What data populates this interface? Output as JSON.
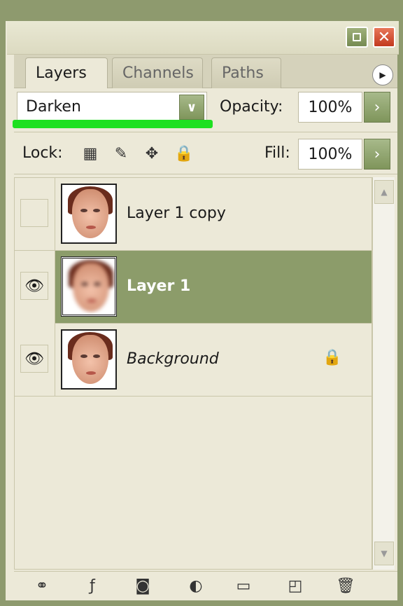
{
  "tabs": [
    {
      "label": "Layers"
    },
    {
      "label": "Channels"
    },
    {
      "label": "Paths"
    }
  ],
  "blend": {
    "value": "Darken"
  },
  "opacity": {
    "label": "Opacity:",
    "value": "100%"
  },
  "lock": {
    "label": "Lock:"
  },
  "fill": {
    "label": "Fill:",
    "value": "100%"
  },
  "layers": [
    {
      "name": "Layer 1 copy",
      "visible": false,
      "selected": false
    },
    {
      "name": "Layer 1",
      "visible": true,
      "selected": true
    },
    {
      "name": "Background",
      "visible": true,
      "selected": false,
      "locked": true
    }
  ],
  "colors": {
    "accent": "#8c9c6a",
    "highlight_line": "#1ee021",
    "close": "#c2391e"
  },
  "icons": {
    "titlebar": [
      "minimize-icon",
      "close-icon"
    ],
    "lock": [
      "lock-transparent-icon",
      "lock-image-icon",
      "lock-position-icon",
      "lock-all-icon"
    ],
    "bottom": [
      "link-layers-icon",
      "layer-style-icon",
      "layer-mask-icon",
      "adjustment-layer-icon",
      "new-group-icon",
      "new-layer-icon",
      "delete-layer-icon"
    ]
  }
}
